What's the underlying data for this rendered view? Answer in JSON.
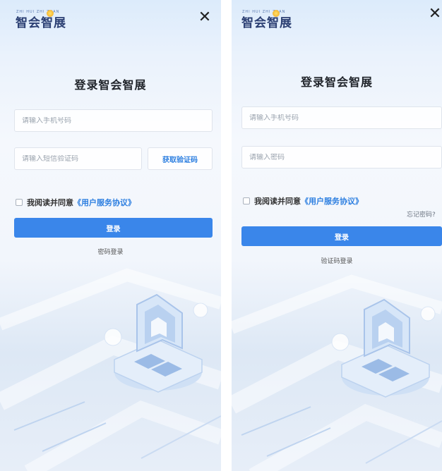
{
  "brand": {
    "logo_text": "智会智展",
    "logo_small": "ZHI HUI ZHI ZHAN"
  },
  "close_icon": "close-icon",
  "sms_login": {
    "title": "登录智会智展",
    "phone_placeholder": "请输入手机号码",
    "code_placeholder": "请输入短信验证码",
    "get_code_label": "获取验证码",
    "agree_text": "我阅读并同意",
    "agreement_link": "《用户服务协议》",
    "login_label": "登录",
    "switch_label": "密码登录"
  },
  "password_login": {
    "title": "登录智会智展",
    "phone_placeholder": "请输入手机号码",
    "password_placeholder": "请输入密码",
    "agree_text": "我阅读并同意",
    "agreement_link": "《用户服务协议》",
    "forgot_label": "忘记密码?",
    "login_label": "登录",
    "switch_label": "验证码登录"
  },
  "colors": {
    "accent": "#3a86ea",
    "link": "#2d7fe0",
    "title": "#1f2329"
  }
}
